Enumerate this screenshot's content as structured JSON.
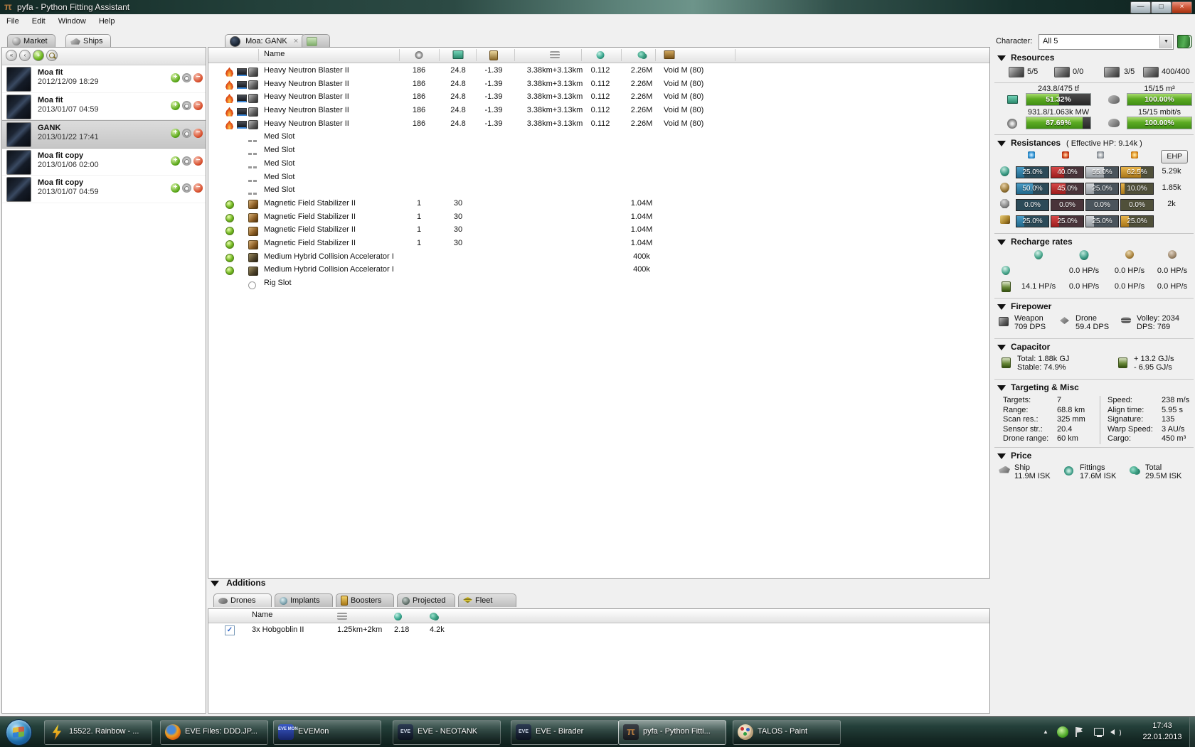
{
  "titlebar": {
    "title": "pyfa - Python Fitting Assistant",
    "minimize_glyph": "—",
    "maximize_glyph": "□",
    "close_glyph": "×"
  },
  "menu": {
    "items": [
      "File",
      "Edit",
      "Window",
      "Help"
    ]
  },
  "left_panel": {
    "tabs": [
      {
        "label": "Market",
        "icon": "market-icon",
        "active": false
      },
      {
        "label": "Ships",
        "icon": "ships-icon",
        "active": true
      }
    ],
    "toolbar": [
      {
        "name": "history-back-button",
        "glyph": "«",
        "style": ""
      },
      {
        "name": "history-forward-button",
        "glyph": "‹",
        "style": ""
      },
      {
        "name": "new-fit-button",
        "glyph": "+",
        "style": "green"
      },
      {
        "name": "search-button",
        "glyph": "",
        "style": "lens"
      }
    ],
    "fits": [
      {
        "name": "Moa fit",
        "date": "2012/12/09 18:29",
        "selected": false
      },
      {
        "name": "Moa fit",
        "date": "2013/01/07 04:59",
        "selected": false
      },
      {
        "name": "GANK",
        "date": "2013/01/22 17:41",
        "selected": true
      },
      {
        "name": "Moa fit copy",
        "date": "2013/01/06 02:00",
        "selected": false
      },
      {
        "name": "Moa fit copy",
        "date": "2013/01/07 04:59",
        "selected": false
      }
    ]
  },
  "fit_tabs": {
    "active_label": "Moa: GANK",
    "close_glyph": "×"
  },
  "fitting": {
    "name_header": "Name",
    "column_icons": [
      "powergrid-icon",
      "cpu-icon",
      "capacitor-icon",
      "range-icon",
      "tracking-icon",
      "price-icon",
      "ammo-icon"
    ],
    "rows": [
      {
        "slot": "high",
        "name": "Heavy Neutron Blaster II",
        "values": [
          "186",
          "24.8",
          "-1.39",
          "3.38km+3.13km",
          "0.112",
          "2.26M"
        ],
        "charge": "Void M (80)"
      },
      {
        "slot": "high",
        "name": "Heavy Neutron Blaster II",
        "values": [
          "186",
          "24.8",
          "-1.39",
          "3.38km+3.13km",
          "0.112",
          "2.26M"
        ],
        "charge": "Void M (80)"
      },
      {
        "slot": "high",
        "name": "Heavy Neutron Blaster II",
        "values": [
          "186",
          "24.8",
          "-1.39",
          "3.38km+3.13km",
          "0.112",
          "2.26M"
        ],
        "charge": "Void M (80)"
      },
      {
        "slot": "high",
        "name": "Heavy Neutron Blaster II",
        "values": [
          "186",
          "24.8",
          "-1.39",
          "3.38km+3.13km",
          "0.112",
          "2.26M"
        ],
        "charge": "Void M (80)"
      },
      {
        "slot": "high",
        "name": "Heavy Neutron Blaster II",
        "values": [
          "186",
          "24.8",
          "-1.39",
          "3.38km+3.13km",
          "0.112",
          "2.26M"
        ],
        "charge": "Void M (80)"
      },
      {
        "slot": "med-empty",
        "name": "Med Slot",
        "values": [
          "",
          "",
          "",
          "",
          "",
          ""
        ],
        "charge": ""
      },
      {
        "slot": "med-empty",
        "name": "Med Slot",
        "values": [
          "",
          "",
          "",
          "",
          "",
          ""
        ],
        "charge": ""
      },
      {
        "slot": "med-empty",
        "name": "Med Slot",
        "values": [
          "",
          "",
          "",
          "",
          "",
          ""
        ],
        "charge": ""
      },
      {
        "slot": "med-empty",
        "name": "Med Slot",
        "values": [
          "",
          "",
          "",
          "",
          "",
          ""
        ],
        "charge": ""
      },
      {
        "slot": "med-empty",
        "name": "Med Slot",
        "values": [
          "",
          "",
          "",
          "",
          "",
          ""
        ],
        "charge": ""
      },
      {
        "slot": "low",
        "name": "Magnetic Field Stabilizer II",
        "values": [
          "1",
          "30",
          "",
          "",
          "",
          "1.04M"
        ],
        "charge": ""
      },
      {
        "slot": "low",
        "name": "Magnetic Field Stabilizer II",
        "values": [
          "1",
          "30",
          "",
          "",
          "",
          "1.04M"
        ],
        "charge": ""
      },
      {
        "slot": "low",
        "name": "Magnetic Field Stabilizer II",
        "values": [
          "1",
          "30",
          "",
          "",
          "",
          "1.04M"
        ],
        "charge": ""
      },
      {
        "slot": "low",
        "name": "Magnetic Field Stabilizer II",
        "values": [
          "1",
          "30",
          "",
          "",
          "",
          "1.04M"
        ],
        "charge": ""
      },
      {
        "slot": "rig",
        "name": "Medium Hybrid Collision Accelerator I",
        "values": [
          "",
          "",
          "",
          "",
          "",
          "400k"
        ],
        "charge": ""
      },
      {
        "slot": "rig",
        "name": "Medium Hybrid Collision Accelerator I",
        "values": [
          "",
          "",
          "",
          "",
          "",
          "400k"
        ],
        "charge": ""
      },
      {
        "slot": "rig-empty",
        "name": "Rig Slot",
        "values": [
          "",
          "",
          "",
          "",
          "",
          ""
        ],
        "charge": ""
      }
    ]
  },
  "right_panel": {
    "character_label": "Character:",
    "character_value": "All 5",
    "resources": {
      "title": "Resources",
      "slots": [
        {
          "icon": "turret-slots-icon",
          "value": "5/5"
        },
        {
          "icon": "launcher-slots-icon",
          "value": "0/0"
        },
        {
          "icon": "rig-slots-icon",
          "value": "3/5"
        },
        {
          "icon": "calibration-icon",
          "value": "400/400"
        }
      ],
      "gauges": [
        {
          "icon": "cpu-icon",
          "label": "243.8/475 tf",
          "percent": 51.32,
          "text": "51.32%"
        },
        {
          "icon": "dronebay-icon",
          "label": "15/15 m³",
          "percent": 100,
          "text": "100.00%"
        },
        {
          "icon": "powergrid-icon",
          "label": "931.8/1.063k MW",
          "percent": 87.69,
          "text": "87.69%"
        },
        {
          "icon": "bandwidth-icon",
          "label": "15/15 mbit/s",
          "percent": 100,
          "text": "100.00%"
        }
      ]
    },
    "resistances": {
      "title": "Resistances",
      "subtitle": "( Effective HP: 9.14k )",
      "ehp_button_label": "EHP",
      "damage_types": [
        "em",
        "thermal",
        "kinetic",
        "explosive"
      ],
      "rows": [
        {
          "icon": "shield-icon",
          "cells": [
            {
              "percent": 25,
              "text": "25.0%"
            },
            {
              "percent": 40,
              "text": "40.0%"
            },
            {
              "percent": 55,
              "text": "55.0%"
            },
            {
              "percent": 62.5,
              "text": "62.5%"
            }
          ],
          "ehp": "5.29k"
        },
        {
          "icon": "armor-icon",
          "cells": [
            {
              "percent": 50,
              "text": "50.0%"
            },
            {
              "percent": 45,
              "text": "45.0%"
            },
            {
              "percent": 25,
              "text": "25.0%"
            },
            {
              "percent": 10,
              "text": "10.0%"
            }
          ],
          "ehp": "1.85k"
        },
        {
          "icon": "hull-icon",
          "cells": [
            {
              "percent": 0,
              "text": "0.0%"
            },
            {
              "percent": 0,
              "text": "0.0%"
            },
            {
              "percent": 0,
              "text": "0.0%"
            },
            {
              "percent": 0,
              "text": "0.0%"
            }
          ],
          "ehp": "2k"
        },
        {
          "icon": "damage-profile-icon",
          "cells": [
            {
              "percent": 25,
              "text": "25.0%"
            },
            {
              "percent": 25,
              "text": "25.0%"
            },
            {
              "percent": 25,
              "text": "25.0%"
            },
            {
              "percent": 25,
              "text": "25.0%"
            }
          ],
          "ehp": ""
        }
      ]
    },
    "recharge": {
      "title": "Recharge rates",
      "column_icons": [
        "shield-boost-icon",
        "shield-icon",
        "armor-repair-icon",
        "hull-repair-icon"
      ],
      "rows": [
        {
          "icon": "shield-boost-icon",
          "values": [
            "",
            "0.0 HP/s",
            "0.0 HP/s",
            "0.0 HP/s"
          ]
        },
        {
          "icon": "capbat-icon",
          "values": [
            "14.1 HP/s",
            "0.0 HP/s",
            "0.0 HP/s",
            "0.0 HP/s"
          ]
        }
      ]
    },
    "firepower": {
      "title": "Firepower",
      "items": [
        {
          "icon": "turret-icon",
          "line1": "Weapon",
          "line2": "709 DPS"
        },
        {
          "icon": "drone-icon",
          "line1": "Drone",
          "line2": "59.4 DPS"
        },
        {
          "icon": "volley-icon",
          "line1": "Volley: 2034",
          "line2": "DPS: 769"
        }
      ]
    },
    "capacitor": {
      "title": "Capacitor",
      "total_label": "Total: 1.88k GJ",
      "stable_label": "Stable: 74.9%",
      "recharge_label": "+ 13.2 GJ/s",
      "usage_label": "- 6.95 GJ/s"
    },
    "targeting": {
      "title": "Targeting & Misc",
      "left_rows": [
        {
          "label": "Targets:",
          "value": "7"
        },
        {
          "label": "Range:",
          "value": "68.8 km"
        },
        {
          "label": "Scan res.:",
          "value": "325 mm"
        },
        {
          "label": "Sensor str.:",
          "value": "20.4"
        },
        {
          "label": "Drone range:",
          "value": "60 km"
        }
      ],
      "right_rows": [
        {
          "label": "Speed:",
          "value": "238 m/s"
        },
        {
          "label": "Align time:",
          "value": "5.95 s"
        },
        {
          "label": "Signature:",
          "value": "135"
        },
        {
          "label": "Warp Speed:",
          "value": "3 AU/s"
        },
        {
          "label": "Cargo:",
          "value": "450 m³"
        }
      ]
    },
    "price": {
      "title": "Price",
      "items": [
        {
          "icon": "ship-price-icon",
          "label": "Ship",
          "value": "11.9M ISK"
        },
        {
          "icon": "fittings-price-icon",
          "label": "Fittings",
          "value": "17.6M ISK"
        },
        {
          "icon": "total-price-icon",
          "label": "Total",
          "value": "29.5M ISK"
        }
      ]
    }
  },
  "additions": {
    "title": "Additions",
    "tabs": [
      {
        "label": "Drones",
        "icon": "drones-icon",
        "active": true
      },
      {
        "label": "Implants",
        "icon": "implants-icon",
        "active": false
      },
      {
        "label": "Boosters",
        "icon": "boosters-icon",
        "active": false
      },
      {
        "label": "Projected",
        "icon": "projected-icon",
        "active": false
      },
      {
        "label": "Fleet",
        "icon": "fleet-icon",
        "active": false
      }
    ],
    "drones_table": {
      "name_header": "Name",
      "column_icons": [
        "range-icon",
        "tracking-icon",
        "price-icon"
      ],
      "rows": [
        {
          "checked": true,
          "check_glyph": "✓",
          "name": "3x Hobgoblin II",
          "range": "1.25km+2km",
          "tracking": "2.18",
          "price": "4.2k"
        }
      ]
    }
  },
  "taskbar": {
    "apps": [
      {
        "icon": "winamp-icon",
        "label": "15522. Rainbow - ...",
        "active": false,
        "icon_text": ""
      },
      {
        "icon": "firefox-icon",
        "label": "EVE Files: DDD.JP...",
        "active": false,
        "icon_text": ""
      },
      {
        "icon": "evemon-icon",
        "label": "EVEMon",
        "active": false,
        "icon_text": "EVE MON"
      },
      {
        "icon": "eve-icon",
        "label": "EVE - NEOTANK",
        "active": false,
        "icon_text": "EVE"
      },
      {
        "icon": "eve-icon",
        "label": "EVE - Birader",
        "active": false,
        "icon_text": "EVE"
      },
      {
        "icon": "pyfa-icon",
        "label": "pyfa - Python Fitti...",
        "active": true,
        "icon_text": "π"
      },
      {
        "icon": "paint-icon",
        "label": "TALOS - Paint",
        "active": false,
        "icon_text": ""
      }
    ],
    "tray": {
      "expand_glyph": "▲",
      "time": "17:43",
      "date": "22.01.2013"
    }
  },
  "colors": {
    "accent_green_bar": "#5cab23",
    "em": "#2d7fae",
    "thermal": "#c03030",
    "kinetic": "#b9bdc2",
    "explosive": "#d29a33",
    "taskbar": "#1d3531"
  }
}
